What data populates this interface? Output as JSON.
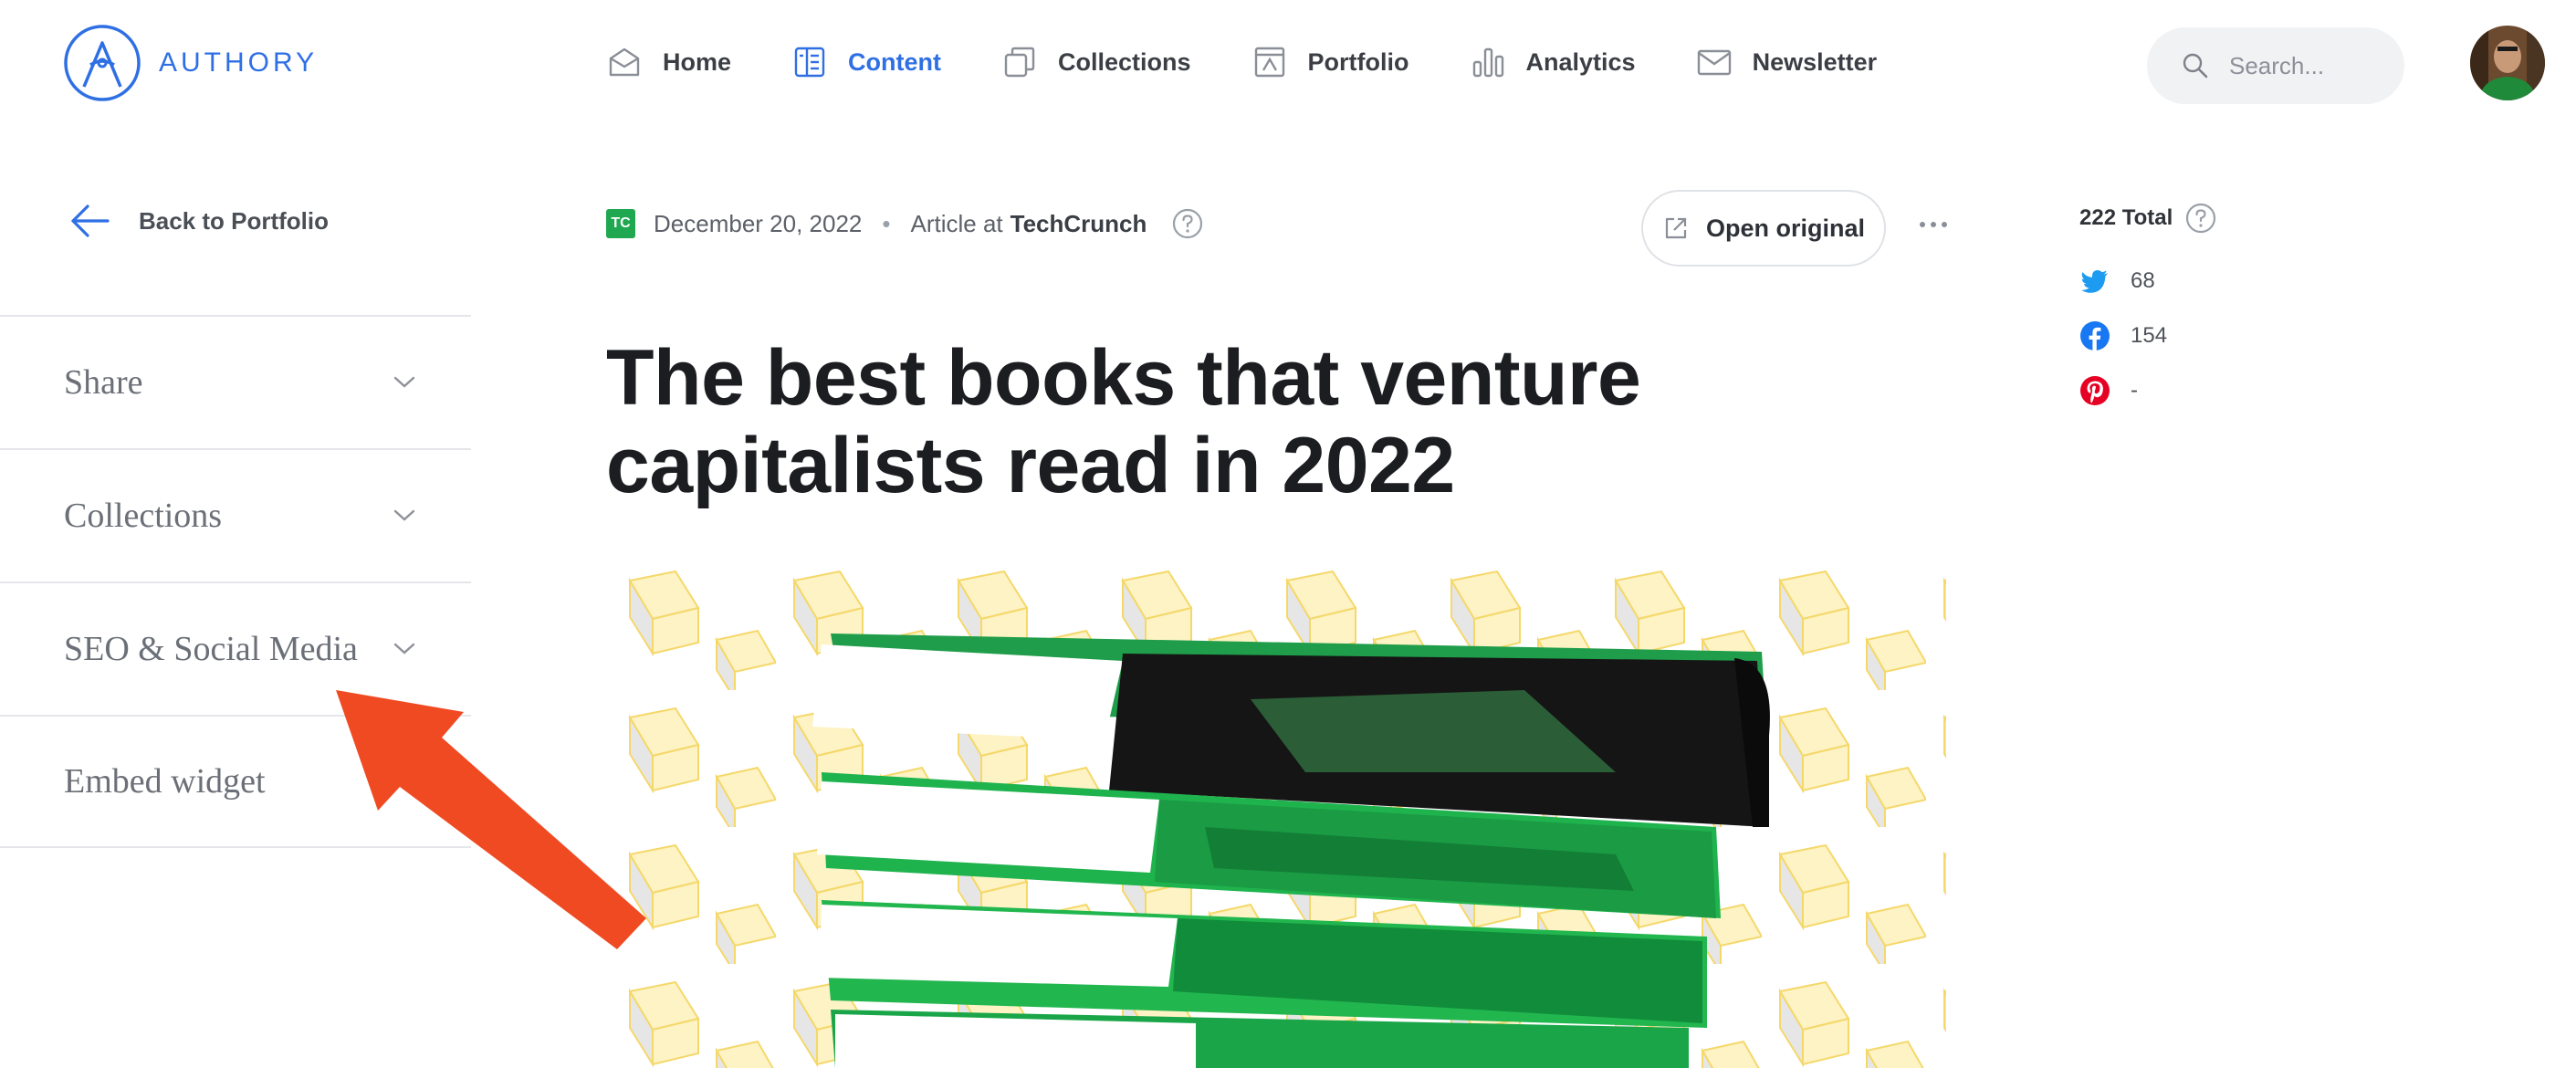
{
  "app": {
    "brand": "AUTHORY",
    "accent_color": "#2f6fe4"
  },
  "nav": {
    "items": [
      {
        "label": "Home",
        "icon": "home-icon",
        "active": false
      },
      {
        "label": "Content",
        "icon": "content-icon",
        "active": true
      },
      {
        "label": "Collections",
        "icon": "collections-icon",
        "active": false
      },
      {
        "label": "Portfolio",
        "icon": "portfolio-icon",
        "active": false
      },
      {
        "label": "Analytics",
        "icon": "analytics-icon",
        "active": false
      },
      {
        "label": "Newsletter",
        "icon": "newsletter-icon",
        "active": false
      }
    ]
  },
  "search": {
    "placeholder": "Search...",
    "value": ""
  },
  "sidebar": {
    "back_label": "Back to Portfolio",
    "sections": [
      {
        "label": "Share"
      },
      {
        "label": "Collections"
      },
      {
        "label": "SEO & Social Media"
      },
      {
        "label": "Embed widget"
      }
    ]
  },
  "article": {
    "publisher_badge": "TC",
    "date": "December 20, 2022",
    "separator": "•",
    "type_prefix": "Article at",
    "publisher": "TechCrunch",
    "open_original_label": "Open original",
    "title": "The best books that venture capitalists read in 2022",
    "hero_icon": "stacked-books-illustration"
  },
  "stats": {
    "total_label": "222 Total",
    "rows": [
      {
        "network": "twitter",
        "icon": "twitter-icon",
        "value": "68",
        "color": "#1d9bf0"
      },
      {
        "network": "facebook",
        "icon": "facebook-icon",
        "value": "154",
        "color": "#1877f2"
      },
      {
        "network": "pinterest",
        "icon": "pinterest-icon",
        "value": "-",
        "color": "#e60023"
      }
    ]
  },
  "annotation": {
    "arrow_color": "#f04a23"
  }
}
